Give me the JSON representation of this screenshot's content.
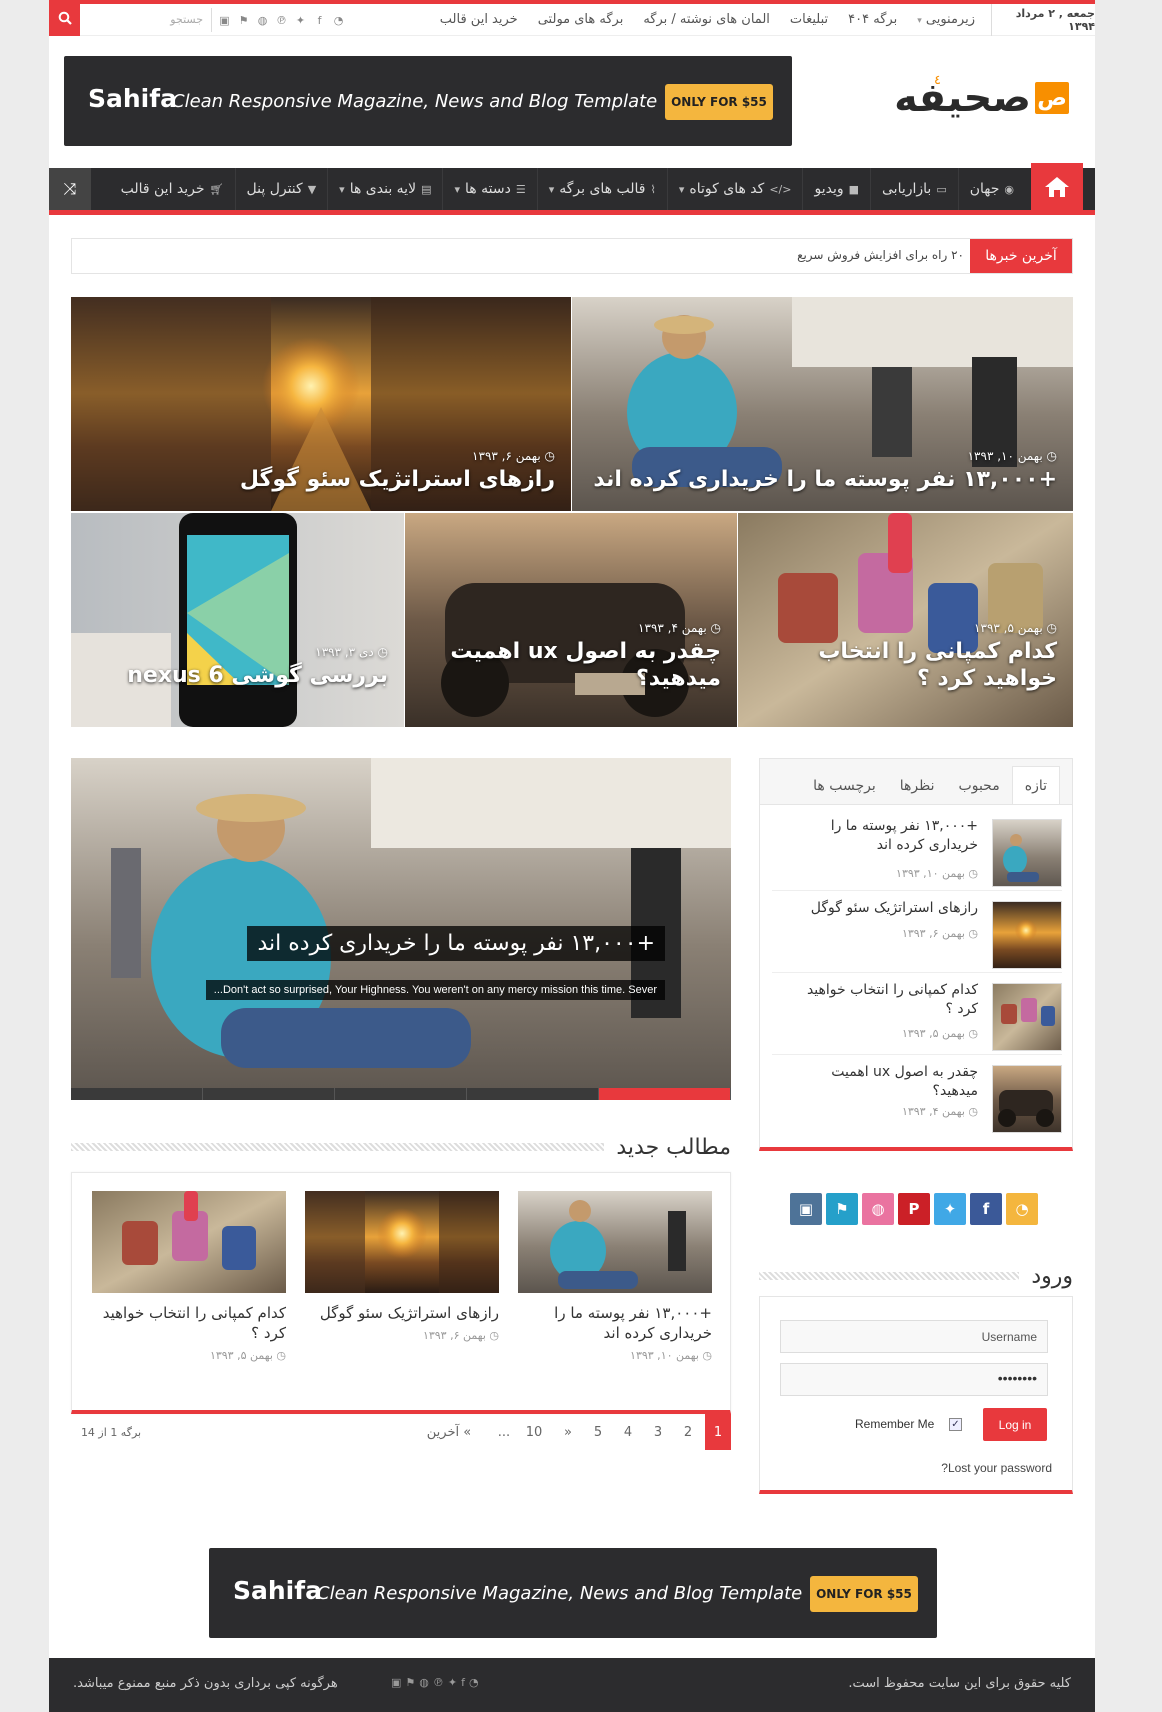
{
  "topbar": {
    "date": "جمعه , ۲ مرداد ۱۳۹۴",
    "menu": [
      "زیرمنویی",
      "برگه ۴۰۴",
      "تبلیغات",
      "المان های نوشته / برگه",
      "برگه های مولتی",
      "خرید این قالب"
    ],
    "search_placeholder": "جستجو",
    "social_icons": [
      "rss-icon",
      "facebook-icon",
      "twitter-icon",
      "pinterest-icon",
      "dribbble-icon",
      "foursquare-icon",
      "instagram-icon"
    ]
  },
  "banner": {
    "name": "Sahifa",
    "tagline": "Clean Responsive Magazine, News and Blog Template",
    "button": "ONLY FOR $55"
  },
  "logo": {
    "mark": "ص",
    "text": "صحیفه",
    "sup": "٤"
  },
  "mainnav": {
    "items": [
      {
        "label": "جهان",
        "icon": "globe-icon"
      },
      {
        "label": "بازاریابی",
        "icon": "money-icon"
      },
      {
        "label": "ویدیو",
        "icon": "video-icon"
      },
      {
        "label": "کد های کوتاه",
        "icon": "code-icon"
      },
      {
        "label": "قالب های برگه",
        "icon": "paperclip-icon"
      },
      {
        "label": "دسته ها",
        "icon": "list-icon"
      },
      {
        "label": "لایه بندی ها",
        "icon": "layout-icon"
      },
      {
        "label": "کنترل پنل",
        "icon": "filter-icon"
      },
      {
        "label": "خرید این قالب",
        "icon": "cart-icon"
      }
    ]
  },
  "ticker": {
    "label": "آخرین خبرها",
    "text": "۲۰ راه برای افزایش فروش سریع"
  },
  "featured": [
    {
      "date": "بهمن ۱۰, ۱۳۹۳",
      "title": "+۱۳,۰۰۰ نفر پوسته ما را خریداری کرده اند"
    },
    {
      "date": "بهمن ۶, ۱۳۹۳",
      "title": "رازهای استراتژیک سئو گوگل"
    },
    {
      "date": "بهمن ۵, ۱۳۹۳",
      "title": "کدام کمپانی را انتخاب خواهید کرد ؟"
    },
    {
      "date": "بهمن ۴, ۱۳۹۳",
      "title": "چقدر به اصول ux اهمیت میدهید؟"
    },
    {
      "date": "دی ۳, ۱۳۹۳",
      "title": "بررسی گوشی nexus 6"
    }
  ],
  "slider": {
    "title": "+۱۳,۰۰۰ نفر پوسته ما را خریداری کرده اند",
    "excerpt": "...Don't act so surprised, Your Highness. You weren't on any mercy mission this time. Sever"
  },
  "recent": {
    "heading": "مطالب جدید",
    "items": [
      {
        "title": "+۱۳,۰۰۰ نفر پوسته ما را خریداری کرده اند",
        "date": "بهمن ۱۰, ۱۳۹۳"
      },
      {
        "title": "رازهای استراتژیک سئو گوگل",
        "date": "بهمن ۶, ۱۳۹۳"
      },
      {
        "title": "کدام کمپانی را انتخاب خواهید کرد ؟",
        "date": "بهمن ۵, ۱۳۹۳"
      }
    ]
  },
  "pager": {
    "pages": [
      "1",
      "2",
      "3",
      "4",
      "5",
      "»",
      "10",
      "...",
      "آخرین «"
    ],
    "info": "برگه 1 از 14"
  },
  "sidebar": {
    "tabs": [
      "تازه",
      "محبوب",
      "نظرها",
      "برچسب ها"
    ],
    "items": [
      {
        "title": "+۱۳,۰۰۰ نفر پوسته ما را خریداری کرده اند",
        "date": "بهمن ۱۰, ۱۳۹۳"
      },
      {
        "title": "رازهای استراتژیک سئو گوگل",
        "date": "بهمن ۶, ۱۳۹۳"
      },
      {
        "title": "کدام کمپانی را انتخاب خواهید کرد ؟",
        "date": "بهمن ۵, ۱۳۹۳"
      },
      {
        "title": "چقدر به اصول ux اهمیت میدهید؟",
        "date": "بهمن ۴, ۱۳۹۳"
      }
    ]
  },
  "social_big": [
    {
      "name": "rss-icon",
      "color": "#f4b63e"
    },
    {
      "name": "facebook-icon",
      "color": "#3b5998"
    },
    {
      "name": "twitter-icon",
      "color": "#40a8e6"
    },
    {
      "name": "pinterest-icon",
      "color": "#cb2027"
    },
    {
      "name": "dribbble-icon",
      "color": "#ea73a0"
    },
    {
      "name": "foursquare-icon",
      "color": "#25a0ca"
    },
    {
      "name": "instagram-icon",
      "color": "#4e7398"
    }
  ],
  "login": {
    "heading": "ورود",
    "username": "Username",
    "password": "••••••••",
    "remember": "Remember Me",
    "button": "Log in",
    "lost": "?Lost your password"
  },
  "footer": {
    "right": "کلیه حقوق برای این سایت محفوظ است.",
    "left": "هرگونه کپی برداری بدون ذکر منبع ممنوع میباشد."
  },
  "colors": {
    "accent": "#e8393d",
    "dark": "#2c2c2e",
    "orange": "#f88f00",
    "yellow": "#f4b63e"
  }
}
